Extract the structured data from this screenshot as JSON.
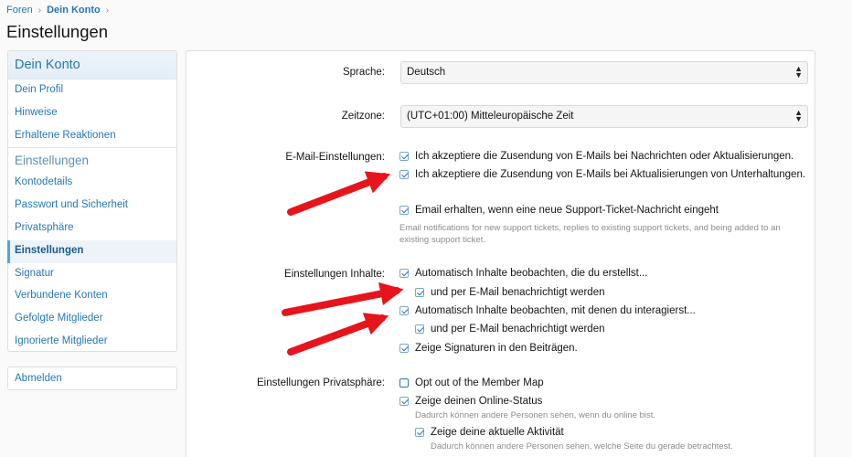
{
  "breadcrumb": {
    "items": [
      "Foren",
      "Dein Konto"
    ],
    "separator": "›"
  },
  "page": {
    "title": "Einstellungen"
  },
  "sidebar": {
    "head": "Dein Konto",
    "group1": [
      "Dein Profil",
      "Hinweise",
      "Erhaltene Reaktionen"
    ],
    "sub": "Einstellungen",
    "group2": [
      "Kontodetails",
      "Passwort und Sicherheit",
      "Privatsphäre",
      "Einstellungen",
      "Signatur",
      "Verbundene Konten",
      "Gefolgte Mitglieder",
      "Ignorierte Mitglieder"
    ],
    "active": "Einstellungen",
    "logout": "Abmelden"
  },
  "form": {
    "language": {
      "label": "Sprache:",
      "value": "Deutsch"
    },
    "timezone": {
      "label": "Zeitzone:",
      "value": "(UTC+01:00) Mitteleuropäische Zeit"
    },
    "email": {
      "label": "E-Mail-Einstellungen:",
      "opt1": "Ich akzeptiere die Zusendung von E-Mails bei Nachrichten oder Aktualisierungen.",
      "opt2": "Ich akzeptiere die Zusendung von E-Mails bei Aktualisierungen von Unterhaltungen.",
      "opt3": "Email erhalten, wenn eine neue Support-Ticket-Nachricht eingeht",
      "hint": "Email notifications for new support tickets, replies to existing support tickets, and being added to an existing support ticket."
    },
    "content": {
      "label": "Einstellungen Inhalte:",
      "opt1": "Automatisch Inhalte beobachten, die du erstellst...",
      "opt1_sub": "und per E-Mail benachrichtigt werden",
      "opt2": "Automatisch Inhalte beobachten, mit denen du interagierst...",
      "opt2_sub": "und per E-Mail benachrichtigt werden",
      "opt3": "Zeige Signaturen in den Beiträgen."
    },
    "privacy": {
      "label": "Einstellungen Privatsphäre:",
      "opt1": "Opt out of the Member Map",
      "opt2": "Zeige deinen Online-Status",
      "opt2_hint": "Dadurch können andere Personen sehen, wenn du online bist.",
      "opt3": "Zeige deine aktuelle Aktivität",
      "opt3_hint": "Dadurch können andere Personen sehen, welche Seite du gerade betrachtest."
    }
  },
  "colors": {
    "link": "#2577b1",
    "arrow": "#e8141b",
    "active_bar": "#47a7eb"
  },
  "icons": {
    "select_arrow": "updown-caret-icon",
    "check": "checkbox-checked-icon"
  }
}
